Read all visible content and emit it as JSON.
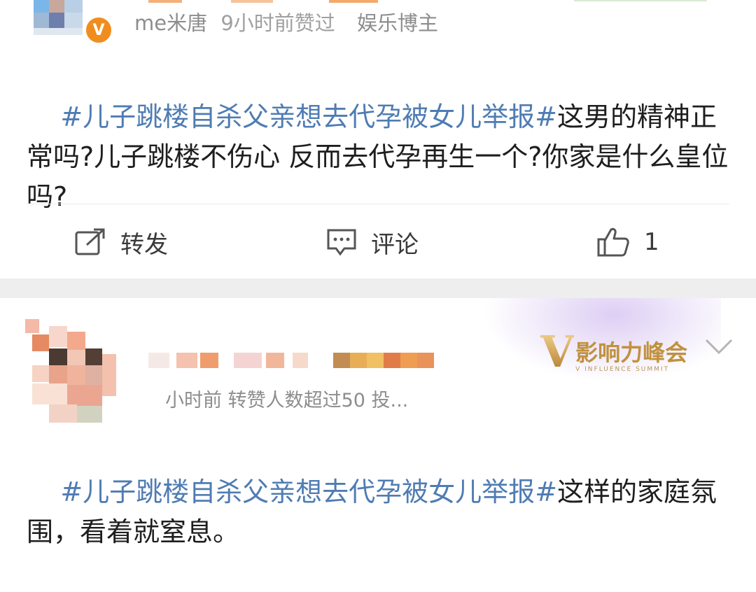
{
  "post1": {
    "author": "me米唐",
    "time_text": "9小时前赞过",
    "author_tag": "娱乐博主",
    "topic": "#儿子跳楼自杀父亲想去代孕被女儿举报#",
    "body": "这男的精神正常吗?儿子跳楼不伤心 反而去代孕再生一个?你家是什么皇位吗?",
    "actions": {
      "repost_label": "转发",
      "comment_label": "评论",
      "like_count": "1"
    }
  },
  "post2": {
    "meta_text": "小时前  转赞人数超过50  投...",
    "badge": {
      "letter": "V",
      "title": "影响力峰会",
      "subtitle": "V INFLUENCE SUMMIT"
    },
    "topic": "#儿子跳楼自杀父亲想去代孕被女儿举报#",
    "body": "这样的家庭氛围，看着就窒息。"
  },
  "colors": {
    "topic_link": "#4f7cb3",
    "separator": "#eeeeee",
    "verified_badge": "#f08d1d"
  },
  "icons": {
    "repost": "repost-icon",
    "comment": "comment-icon",
    "like": "thumbs-up-icon",
    "verified": "verified-v-icon",
    "expand": "chevron-down-icon"
  }
}
